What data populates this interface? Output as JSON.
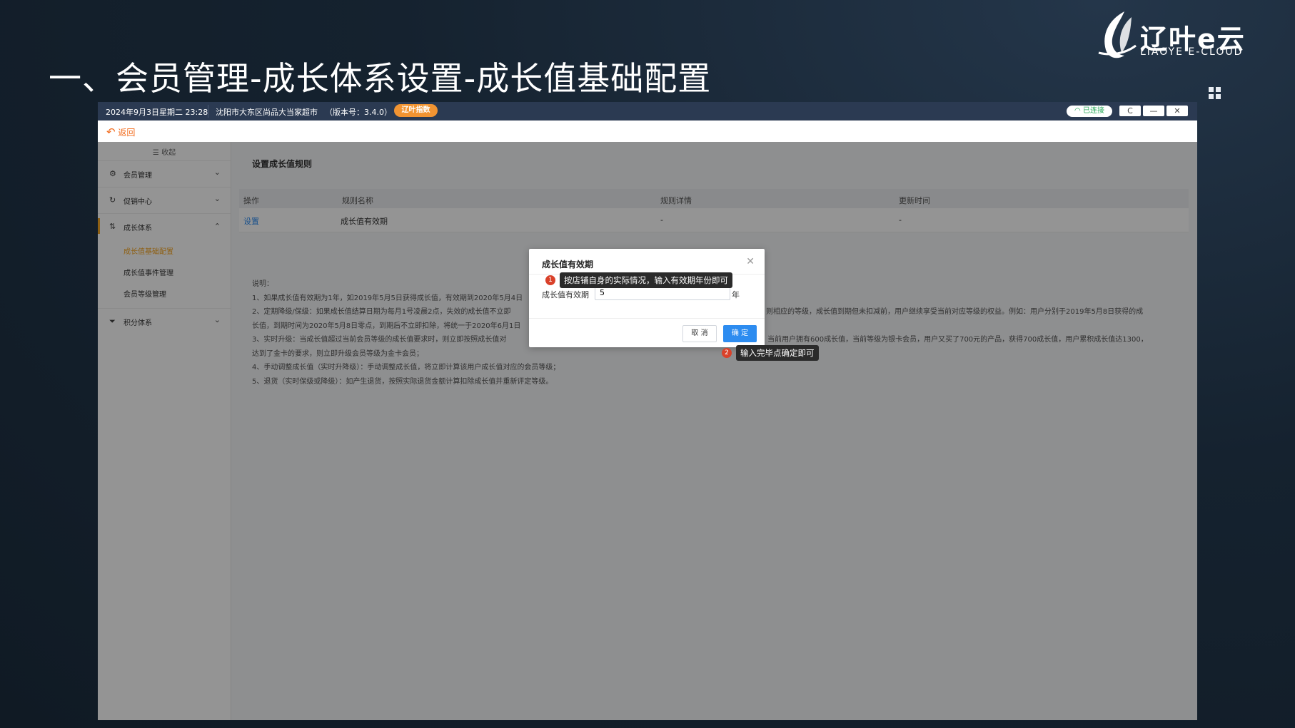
{
  "slide": {
    "title": "一、会员管理-成长体系设置-成长值基础配置",
    "logo_cn": "辽叶e云",
    "logo_en": "LIAOYE E-CLOUD"
  },
  "topbar": {
    "datetime": "2024年9月3日星期二 23:28",
    "store": "沈阳市大东区尚品大当家超市",
    "version": "（版本号：3.4.0）",
    "badge": "辽叶指数",
    "connection": "已连接",
    "refresh": "C",
    "minimize": "—",
    "close": "✕"
  },
  "backbar": {
    "back_label": "返回"
  },
  "sidebar": {
    "collapse_label": "收起",
    "items": [
      {
        "label": "会员管理"
      },
      {
        "label": "促销中心"
      },
      {
        "label": "成长体系"
      },
      {
        "label": "积分体系"
      }
    ],
    "subitems": [
      {
        "label": "成长值基础配置",
        "active": true
      },
      {
        "label": "成长值事件管理"
      },
      {
        "label": "会员等级管理"
      }
    ]
  },
  "main": {
    "section_title": "设置成长值规则",
    "table": {
      "headers": [
        "操作",
        "规则名称",
        "规则详情",
        "更新时间"
      ],
      "rows": [
        {
          "action": "设置",
          "name": "成长值有效期",
          "detail": "-",
          "updated": "-"
        }
      ]
    },
    "notes": [
      "说明：",
      "1、如果成长值有效期为1年，如2019年5月5日获得成长值，有效期到2020年5月4日",
      "2、定期降级/保级：如果成长值结算日期为每月1号凌晨2点，失效的成长值不立即",
      "则相应的等级，成长值到期但未扣减前，用户继续享受当前对应等级的权益。例如：用户分别于2019年5月8日获得的成",
      "长值，到期时间为2020年5月8日零点，到期后不立即扣除，将统一于2020年6月1日",
      "3、实时升级：当成长值超过当前会员等级的成长值要求时，则立即按照成长值对",
      "，当前用户拥有600成长值，当前等级为银卡会员，用户又买了700元的产品，获得700成长值，用户累积成长值达1300，",
      "达到了金卡的要求，则立即升级会员等级为金卡会员；",
      "4、手动调整成长值（实时升降级）：手动调整成长值，将立即计算该用户成长值对应的会员等级；",
      "5、退货（实时保级或降级）：如产生退货，按照实际退货金额计算扣除成长值并重新评定等级。"
    ]
  },
  "modal": {
    "title": "成长值有效期",
    "field_label": "成长值有效期",
    "field_value": "5",
    "unit": "年",
    "cancel_label": "取 消",
    "ok_label": "确 定"
  },
  "tips": [
    {
      "num": "1",
      "text": "按店铺自身的实际情况，输入有效期年份即可"
    },
    {
      "num": "2",
      "text": "输入完毕点确定即可"
    }
  ],
  "colors": {
    "accent_blue": "#2d8cf0",
    "active_orange": "#f5a623",
    "back_orange": "#f26b1d",
    "topbar_bg": "#2b3a52",
    "tip_number_red": "#d9412a"
  }
}
